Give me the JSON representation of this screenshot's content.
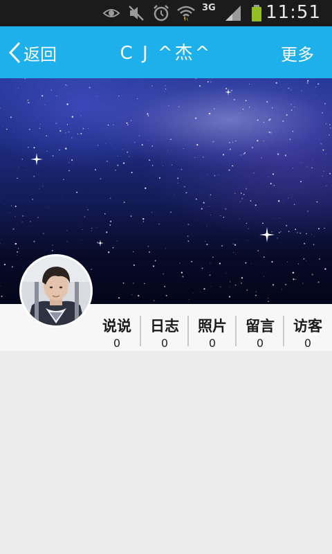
{
  "status_bar": {
    "time": "11:51",
    "network": "3G",
    "icons": [
      "eye-icon",
      "mute-icon",
      "alarm-icon",
      "wifi-icon",
      "signal-icon",
      "battery-icon"
    ]
  },
  "header": {
    "back_label": "返回",
    "title": "C J ^杰^",
    "more_label": "更多",
    "background": "#1eb0ea"
  },
  "profile": {
    "cover_image": "starry-sky-cover",
    "avatar": "user-avatar"
  },
  "stats": [
    {
      "label": "说说",
      "count": "0"
    },
    {
      "label": "日志",
      "count": "0"
    },
    {
      "label": "照片",
      "count": "0"
    },
    {
      "label": "留言",
      "count": "0"
    },
    {
      "label": "访客",
      "count": "0"
    }
  ]
}
